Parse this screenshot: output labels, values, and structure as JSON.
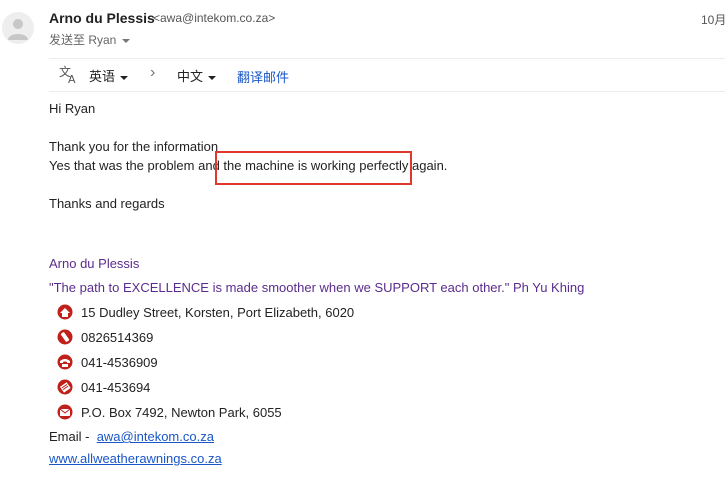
{
  "header": {
    "sender_name": "Arno du Plessis",
    "sender_email": "<awa@intekom.co.za>",
    "date": "10月",
    "to_label": "发送至 Ryan"
  },
  "translate_bar": {
    "source_lang": "英语",
    "target_lang": "中文",
    "translate_link": "翻译邮件"
  },
  "body": {
    "greeting": "Hi Ryan",
    "line1": "Thank you for the information",
    "line2": "Yes that was the problem and the machine is working perfectly again.",
    "closing": "Thanks and regards"
  },
  "signature": {
    "name": "Arno du Plessis",
    "quote": "\"The path to EXCELLENCE is made smoother when we SUPPORT each other.\" Ph Yu Khing",
    "address": "15 Dudley Street, Korsten, Port Elizabeth, 6020",
    "mobile": "0826514369",
    "phone": "041-4536909",
    "fax": "041-453694",
    "postal": "P.O. Box 7492, Newton Park, 6055",
    "email_label": "Email -",
    "email_link": "awa@intekom.co.za",
    "website": "www.allweatherawnings.co.za"
  },
  "colors": {
    "signature": "#5b2c8e",
    "link": "#1a56c8",
    "highlight": "#e0382d"
  }
}
